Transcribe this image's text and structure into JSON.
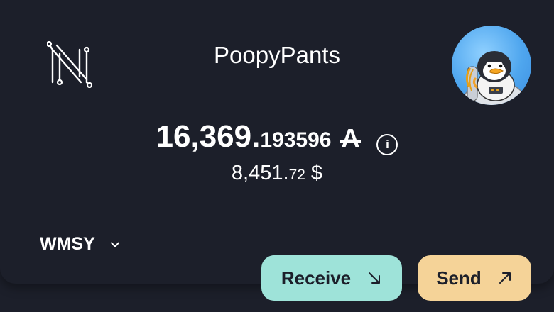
{
  "header": {
    "account_name": "PoopyPants",
    "logo_icon": "network-n-logo-icon",
    "avatar_icon": "penguin-astronaut-avatar"
  },
  "balance": {
    "integer": "16,369.",
    "decimal": "193596",
    "currency_symbol": "A"
  },
  "fiat": {
    "integer": "8,451.",
    "decimal": "72",
    "currency_symbol": "$"
  },
  "token_selector": {
    "selected": "WMSY"
  },
  "actions": {
    "receive_label": "Receive",
    "send_label": "Send"
  },
  "colors": {
    "background": "#1c1f2a",
    "receive_button": "#9ee3d9",
    "send_button": "#f5d398",
    "text": "#ffffff"
  }
}
